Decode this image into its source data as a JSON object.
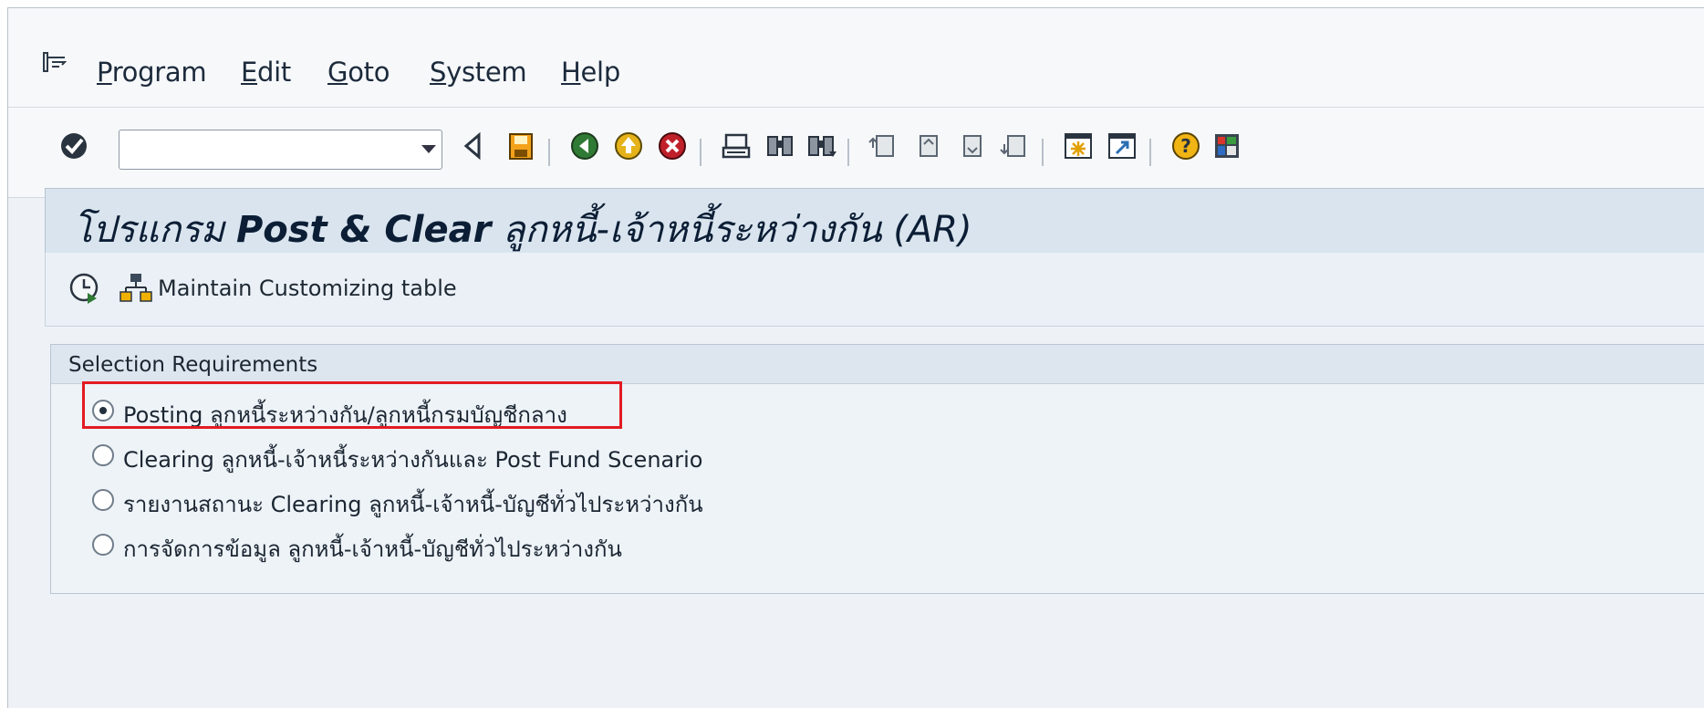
{
  "menubar": {
    "items": [
      {
        "mnemonic": "P",
        "rest": "rogram"
      },
      {
        "mnemonic": "E",
        "rest": "dit"
      },
      {
        "mnemonic": "G",
        "rest": "oto"
      },
      {
        "mnemonic": "S",
        "rest": "ystem"
      },
      {
        "mnemonic": "H",
        "rest": "elp"
      }
    ]
  },
  "toolbar": {
    "command_field_value": "",
    "icons": [
      "enter-icon",
      "back-arrow-icon",
      "save-icon",
      "back-icon",
      "exit-icon",
      "cancel-icon",
      "print-icon",
      "find-icon",
      "find-next-icon",
      "first-page-icon",
      "previous-page-icon",
      "next-page-icon",
      "last-page-icon",
      "create-session-icon",
      "shortcut-icon",
      "help-icon",
      "customize-layout-icon"
    ]
  },
  "title": {
    "prefix": "โปรแกรม ",
    "bold": "Post & Clear",
    "suffix": " ลูกหนี้-เจ้าหนี้ระหว่างกัน (AR)"
  },
  "app_toolbar": {
    "execute_icon": "execute-clock-icon",
    "hierarchy_icon": "hierarchy-icon",
    "maintain_label": "Maintain Customizing table"
  },
  "selection": {
    "title": "Selection Requirements",
    "options": [
      {
        "label": "Posting ลูกหนี้ระหว่างกัน/ลูกหนี้กรมบัญชีกลาง",
        "checked": true
      },
      {
        "label": "Clearing ลูกหนี้-เจ้าหนี้ระหว่างกันและ Post Fund Scenario",
        "checked": false
      },
      {
        "label": "รายงานสถานะ Clearing ลูกหนี้-เจ้าหนี้-บัญชีทั่วไประหว่างกัน",
        "checked": false
      },
      {
        "label": "การจัดการข้อมูล ลูกหนี้-เจ้าหนี้-บัญชีทั่วไประหว่างกัน",
        "checked": false
      }
    ]
  },
  "colors": {
    "highlight": "#e31b23",
    "title_bar": "#d9e4ee",
    "group_header": "#dde6ef"
  }
}
